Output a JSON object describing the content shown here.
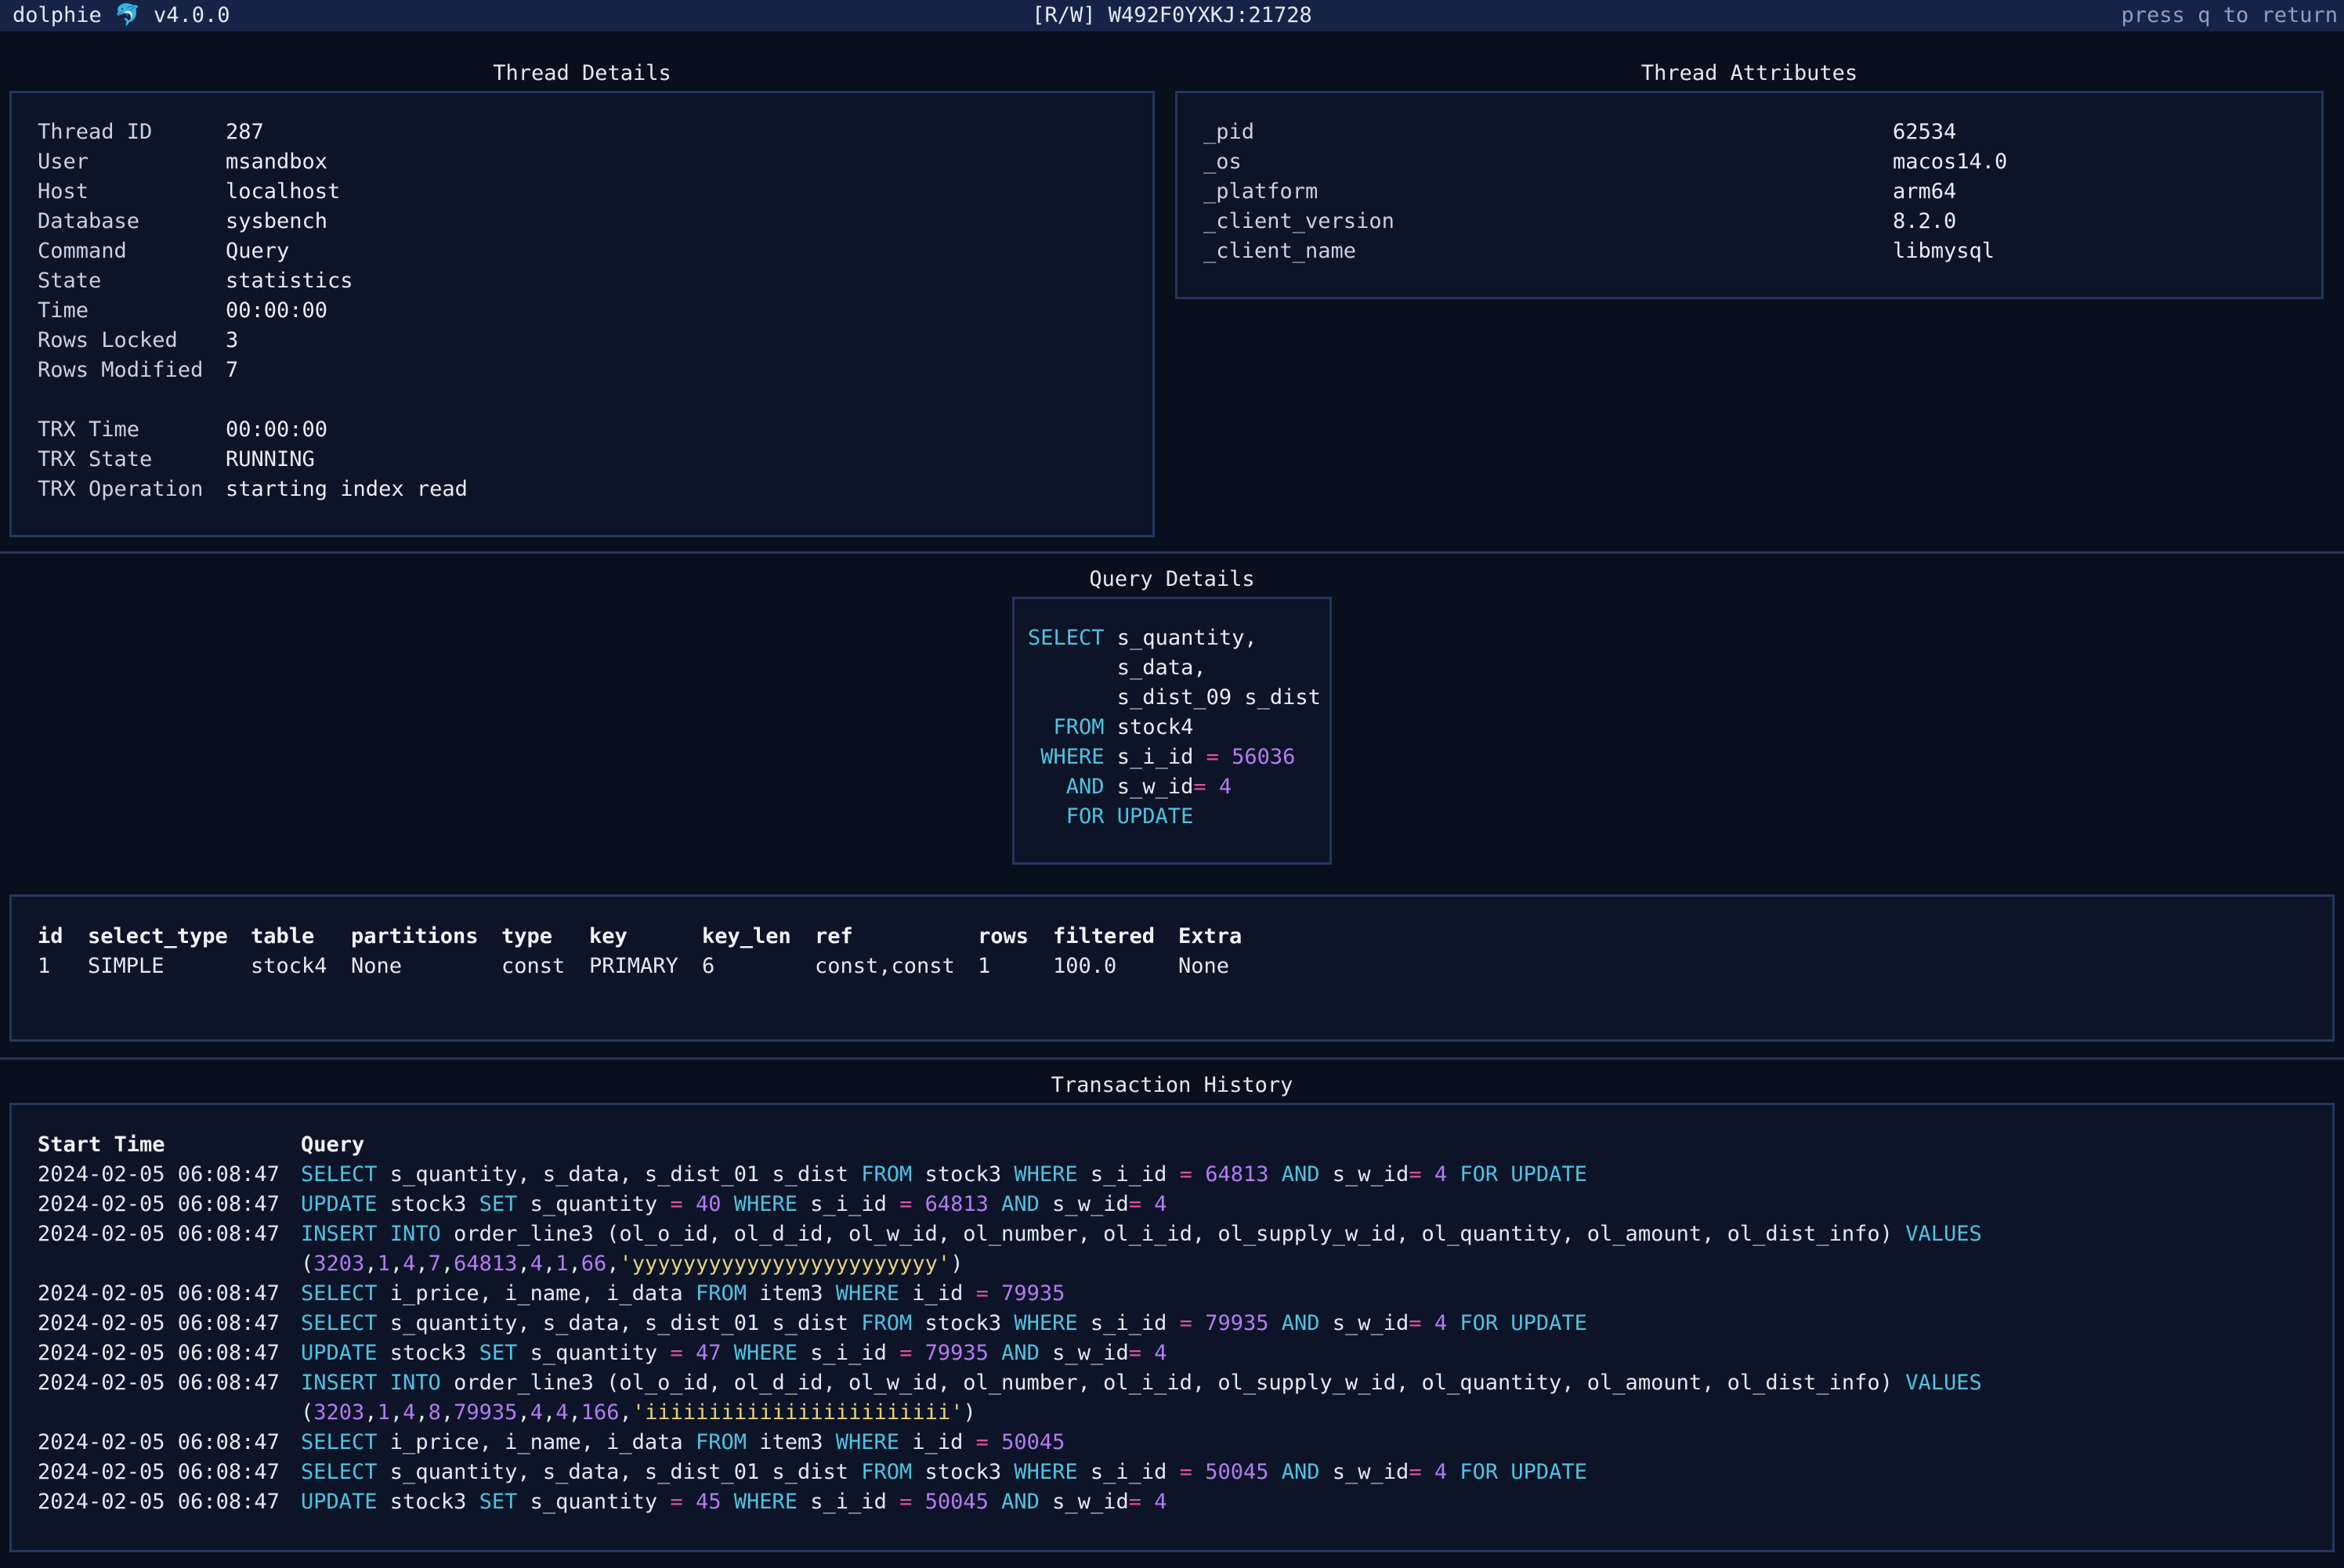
{
  "topbar": {
    "app_name": "dolphie",
    "app_icon": "dolphin-icon",
    "version": "v4.0.0",
    "server": "[R/W] W492F0YXKJ:21728",
    "hint": "press q to return"
  },
  "thread_details": {
    "title": "Thread Details",
    "rows": [
      {
        "key": "Thread ID",
        "value": "287"
      },
      {
        "key": "User",
        "value": "msandbox"
      },
      {
        "key": "Host",
        "value": "localhost"
      },
      {
        "key": "Database",
        "value": "sysbench"
      },
      {
        "key": "Command",
        "value": "Query"
      },
      {
        "key": "State",
        "value": "statistics"
      },
      {
        "key": "Time",
        "value": "00:00:00"
      },
      {
        "key": "Rows Locked",
        "value": "3"
      },
      {
        "key": "Rows Modified",
        "value": "7"
      },
      {
        "key": "",
        "value": ""
      },
      {
        "key": "TRX Time",
        "value": "00:00:00"
      },
      {
        "key": "TRX State",
        "value": "RUNNING"
      },
      {
        "key": "TRX Operation",
        "value": "starting index read"
      }
    ]
  },
  "thread_attributes": {
    "title": "Thread Attributes",
    "rows": [
      {
        "key": "_pid",
        "value": "62534"
      },
      {
        "key": "_os",
        "value": "macos14.0"
      },
      {
        "key": "_platform",
        "value": "arm64"
      },
      {
        "key": "_client_version",
        "value": "8.2.0"
      },
      {
        "key": "_client_name",
        "value": "libmysql"
      }
    ]
  },
  "query_details": {
    "title": "Query Details",
    "lines": [
      [
        [
          "kw",
          "SELECT"
        ],
        [
          "t",
          " s_quantity,"
        ]
      ],
      [
        [
          "t",
          "       s_data,"
        ]
      ],
      [
        [
          "t",
          "       s_dist_09 s_dist"
        ]
      ],
      [
        [
          "kw",
          "  FROM"
        ],
        [
          "t",
          " stock4"
        ]
      ],
      [
        [
          "kw",
          " WHERE"
        ],
        [
          "t",
          " s_i_id "
        ],
        [
          "op",
          "="
        ],
        [
          "num",
          " 56036"
        ]
      ],
      [
        [
          "kw",
          "   AND"
        ],
        [
          "t",
          " s_w_id"
        ],
        [
          "op",
          "="
        ],
        [
          "num",
          " 4"
        ]
      ],
      [
        [
          "kw",
          "   FOR UPDATE"
        ]
      ]
    ]
  },
  "explain": {
    "columns": [
      "id",
      "select_type",
      "table",
      "partitions",
      "type",
      "key",
      "key_len",
      "ref",
      "rows",
      "filtered",
      "Extra"
    ],
    "rows": [
      [
        "1",
        "SIMPLE",
        "stock4",
        "None",
        "const",
        "PRIMARY",
        "6",
        "const,const",
        "1",
        "100.0",
        "None"
      ]
    ]
  },
  "history": {
    "title": "Transaction History",
    "col_start": "Start Time",
    "col_query": "Query",
    "rows": [
      {
        "start": "2024-02-05 06:08:47",
        "query": [
          [
            [
              "kw",
              "SELECT"
            ],
            [
              "t",
              " s_quantity, s_data, s_dist_01 s_dist "
            ],
            [
              "kw",
              "FROM"
            ],
            [
              "t",
              " stock3 "
            ],
            [
              "kw",
              "WHERE"
            ],
            [
              "t",
              " s_i_id "
            ],
            [
              "op",
              "="
            ],
            [
              "num",
              " 64813 "
            ],
            [
              "kw",
              "AND"
            ],
            [
              "t",
              " s_w_id"
            ],
            [
              "op",
              "="
            ],
            [
              "num",
              " 4 "
            ],
            [
              "kw",
              "FOR UPDATE"
            ]
          ]
        ]
      },
      {
        "start": "2024-02-05 06:08:47",
        "query": [
          [
            [
              "kw",
              "UPDATE"
            ],
            [
              "t",
              " stock3 "
            ],
            [
              "kw",
              "SET"
            ],
            [
              "t",
              " s_quantity "
            ],
            [
              "op",
              "="
            ],
            [
              "num",
              " 40 "
            ],
            [
              "kw",
              "WHERE"
            ],
            [
              "t",
              " s_i_id "
            ],
            [
              "op",
              "="
            ],
            [
              "num",
              " 64813 "
            ],
            [
              "kw",
              "AND"
            ],
            [
              "t",
              " s_w_id"
            ],
            [
              "op",
              "="
            ],
            [
              "num",
              " 4"
            ]
          ]
        ]
      },
      {
        "start": "2024-02-05 06:08:47",
        "query": [
          [
            [
              "kw",
              "INSERT INTO"
            ],
            [
              "t",
              " order_line3 (ol_o_id, ol_d_id, ol_w_id, ol_number, ol_i_id, ol_supply_w_id, ol_quantity, ol_amount, ol_dist_info) "
            ],
            [
              "kw",
              "VALUES"
            ]
          ],
          [
            [
              "t",
              "("
            ],
            [
              "num",
              "3203"
            ],
            [
              "t",
              ","
            ],
            [
              "num",
              "1"
            ],
            [
              "t",
              ","
            ],
            [
              "num",
              "4"
            ],
            [
              "t",
              ","
            ],
            [
              "num",
              "7"
            ],
            [
              "t",
              ","
            ],
            [
              "num",
              "64813"
            ],
            [
              "t",
              ","
            ],
            [
              "num",
              "4"
            ],
            [
              "t",
              ","
            ],
            [
              "num",
              "1"
            ],
            [
              "t",
              ","
            ],
            [
              "num",
              "66"
            ],
            [
              "t",
              ","
            ],
            [
              "str",
              "'yyyyyyyyyyyyyyyyyyyyyyyy'"
            ],
            [
              "t",
              ")"
            ]
          ]
        ]
      },
      {
        "start": "2024-02-05 06:08:47",
        "query": [
          [
            [
              "kw",
              "SELECT"
            ],
            [
              "t",
              " i_price, i_name, i_data "
            ],
            [
              "kw",
              "FROM"
            ],
            [
              "t",
              " item3 "
            ],
            [
              "kw",
              "WHERE"
            ],
            [
              "t",
              " i_id "
            ],
            [
              "op",
              "="
            ],
            [
              "num",
              " 79935"
            ]
          ]
        ]
      },
      {
        "start": "2024-02-05 06:08:47",
        "query": [
          [
            [
              "kw",
              "SELECT"
            ],
            [
              "t",
              " s_quantity, s_data, s_dist_01 s_dist "
            ],
            [
              "kw",
              "FROM"
            ],
            [
              "t",
              " stock3 "
            ],
            [
              "kw",
              "WHERE"
            ],
            [
              "t",
              " s_i_id "
            ],
            [
              "op",
              "="
            ],
            [
              "num",
              " 79935 "
            ],
            [
              "kw",
              "AND"
            ],
            [
              "t",
              " s_w_id"
            ],
            [
              "op",
              "="
            ],
            [
              "num",
              " 4 "
            ],
            [
              "kw",
              "FOR UPDATE"
            ]
          ]
        ]
      },
      {
        "start": "2024-02-05 06:08:47",
        "query": [
          [
            [
              "kw",
              "UPDATE"
            ],
            [
              "t",
              " stock3 "
            ],
            [
              "kw",
              "SET"
            ],
            [
              "t",
              " s_quantity "
            ],
            [
              "op",
              "="
            ],
            [
              "num",
              " 47 "
            ],
            [
              "kw",
              "WHERE"
            ],
            [
              "t",
              " s_i_id "
            ],
            [
              "op",
              "="
            ],
            [
              "num",
              " 79935 "
            ],
            [
              "kw",
              "AND"
            ],
            [
              "t",
              " s_w_id"
            ],
            [
              "op",
              "="
            ],
            [
              "num",
              " 4"
            ]
          ]
        ]
      },
      {
        "start": "2024-02-05 06:08:47",
        "query": [
          [
            [
              "kw",
              "INSERT INTO"
            ],
            [
              "t",
              " order_line3 (ol_o_id, ol_d_id, ol_w_id, ol_number, ol_i_id, ol_supply_w_id, ol_quantity, ol_amount, ol_dist_info) "
            ],
            [
              "kw",
              "VALUES"
            ]
          ],
          [
            [
              "t",
              "("
            ],
            [
              "num",
              "3203"
            ],
            [
              "t",
              ","
            ],
            [
              "num",
              "1"
            ],
            [
              "t",
              ","
            ],
            [
              "num",
              "4"
            ],
            [
              "t",
              ","
            ],
            [
              "num",
              "8"
            ],
            [
              "t",
              ","
            ],
            [
              "num",
              "79935"
            ],
            [
              "t",
              ","
            ],
            [
              "num",
              "4"
            ],
            [
              "t",
              ","
            ],
            [
              "num",
              "4"
            ],
            [
              "t",
              ","
            ],
            [
              "num",
              "166"
            ],
            [
              "t",
              ","
            ],
            [
              "str",
              "'iiiiiiiiiiiiiiiiiiiiiiii'"
            ],
            [
              "t",
              ")"
            ]
          ]
        ]
      },
      {
        "start": "2024-02-05 06:08:47",
        "query": [
          [
            [
              "kw",
              "SELECT"
            ],
            [
              "t",
              " i_price, i_name, i_data "
            ],
            [
              "kw",
              "FROM"
            ],
            [
              "t",
              " item3 "
            ],
            [
              "kw",
              "WHERE"
            ],
            [
              "t",
              " i_id "
            ],
            [
              "op",
              "="
            ],
            [
              "num",
              " 50045"
            ]
          ]
        ]
      },
      {
        "start": "2024-02-05 06:08:47",
        "query": [
          [
            [
              "kw",
              "SELECT"
            ],
            [
              "t",
              " s_quantity, s_data, s_dist_01 s_dist "
            ],
            [
              "kw",
              "FROM"
            ],
            [
              "t",
              " stock3 "
            ],
            [
              "kw",
              "WHERE"
            ],
            [
              "t",
              " s_i_id "
            ],
            [
              "op",
              "="
            ],
            [
              "num",
              " 50045 "
            ],
            [
              "kw",
              "AND"
            ],
            [
              "t",
              " s_w_id"
            ],
            [
              "op",
              "="
            ],
            [
              "num",
              " 4 "
            ],
            [
              "kw",
              "FOR UPDATE"
            ]
          ]
        ]
      },
      {
        "start": "2024-02-05 06:08:47",
        "query": [
          [
            [
              "kw",
              "UPDATE"
            ],
            [
              "t",
              " stock3 "
            ],
            [
              "kw",
              "SET"
            ],
            [
              "t",
              " s_quantity "
            ],
            [
              "op",
              "="
            ],
            [
              "num",
              " 45 "
            ],
            [
              "kw",
              "WHERE"
            ],
            [
              "t",
              " s_i_id "
            ],
            [
              "op",
              "="
            ],
            [
              "num",
              " 50045 "
            ],
            [
              "kw",
              "AND"
            ],
            [
              "t",
              " s_w_id"
            ],
            [
              "op",
              "="
            ],
            [
              "num",
              " 4"
            ]
          ]
        ]
      }
    ]
  },
  "colors": {
    "background": "#0a0f1d",
    "topbar": "#162346",
    "border": "#25355c",
    "keyword": "#4fc3e0",
    "number": "#b57bf2",
    "operator": "#e04fa5",
    "string": "#e6d277"
  }
}
